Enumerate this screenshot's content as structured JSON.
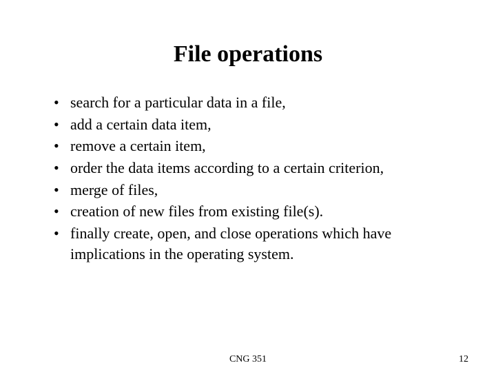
{
  "title": "File operations",
  "bullets": [
    "search for a particular data in a file,",
    "add a certain data item,",
    "remove a certain item,",
    "order the data items according to a certain criterion,",
    "merge of files,",
    "creation of new files from existing file(s).",
    "finally create, open, and close operations which have implications in the operating system."
  ],
  "footer": {
    "center": "CNG 351",
    "page": "12"
  }
}
